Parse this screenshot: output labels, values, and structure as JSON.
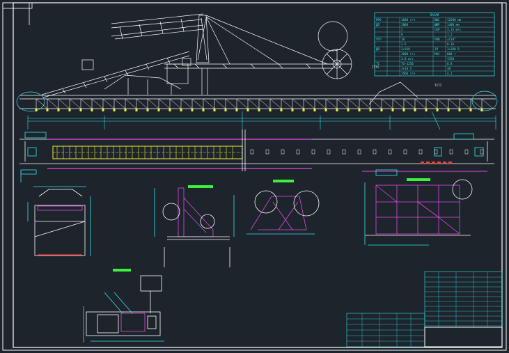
{
  "drawing": {
    "background": "#1d242b",
    "colors": {
      "white": "#ffffff",
      "cyan": "#36e6ee",
      "magenta": "#e14ae8",
      "yellow": "#f0ee3c",
      "green": "#3ef03c",
      "red": "#ff3838",
      "gray": "#9aa4ad"
    }
  },
  "spec_table": {
    "title": "ПАРАМ",
    "rows": [
      {
        "k": "ПРО",
        "n": "",
        "v": "1600 т/ч",
        "k2": "ВЫС",
        "v2": "12500 мм"
      },
      {
        "k": "ДЛ",
        "n": "",
        "v": "1000",
        "k2": "ШИР",
        "v2": "1400 мм"
      },
      {
        "k": "",
        "n": "",
        "v": "2",
        "k2": "СКР",
        "v2": "3.15 м/с"
      },
      {
        "k": "",
        "n": "",
        "v": "0",
        "k2": "",
        "v2": "1.2"
      },
      {
        "k": "УГЛ",
        "n": "",
        "v": "18",
        "k2": "ПОВ",
        "v2": "±110°"
      },
      {
        "k": "",
        "n": "",
        "v": "2.5",
        "k2": "",
        "v2": "0.16"
      },
      {
        "k": "ДВ",
        "n": "",
        "v": "2×160",
        "k2": "ЭЛ",
        "v2": "3×380 В"
      },
      {
        "k": "",
        "n": "",
        "v": "1600 т/ч",
        "k2": "МАС",
        "v2": "860 т"
      },
      {
        "k": "",
        "n": "",
        "v": "3.8 м/с",
        "k2": "",
        "v2": "1760"
      },
      {
        "k": "Т1",
        "n": "",
        "v": "ТО-3250",
        "k2": "",
        "v2": "0.8"
      },
      {
        "k": "",
        "n": "",
        "v": "3×18.5",
        "k2": "",
        "v2": "30"
      },
      {
        "k": "",
        "n": "",
        "v": "1560 т/ч",
        "k2": "",
        "v2": "4.1"
      }
    ]
  },
  "labels": {
    "elevation_tag": "7177",
    "section_tag": "7771"
  }
}
